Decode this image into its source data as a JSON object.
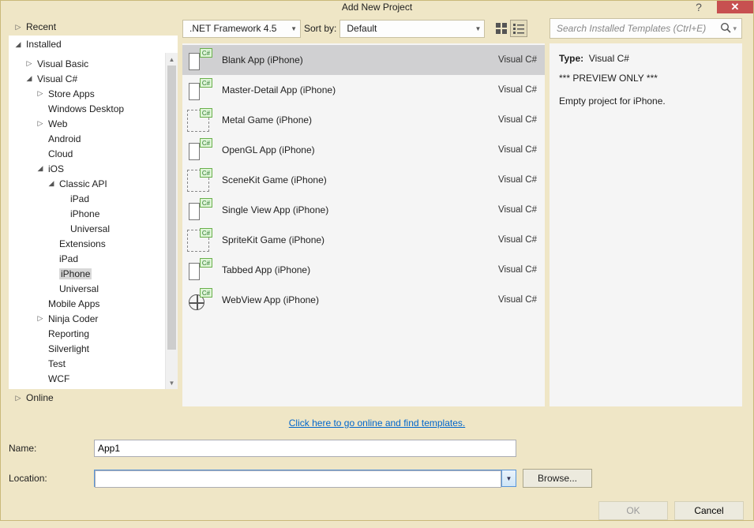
{
  "window": {
    "title": "Add New Project"
  },
  "tree": {
    "recent": "Recent",
    "installed": "Installed",
    "online": "Online",
    "items": [
      {
        "label": "Visual Basic",
        "indent": 1,
        "exp": "▷"
      },
      {
        "label": "Visual C#",
        "indent": 1,
        "exp": "◢"
      },
      {
        "label": "Store Apps",
        "indent": 2,
        "exp": "▷"
      },
      {
        "label": "Windows Desktop",
        "indent": 2,
        "exp": ""
      },
      {
        "label": "Web",
        "indent": 2,
        "exp": "▷"
      },
      {
        "label": "Android",
        "indent": 2,
        "exp": ""
      },
      {
        "label": "Cloud",
        "indent": 2,
        "exp": ""
      },
      {
        "label": "iOS",
        "indent": 2,
        "exp": "◢"
      },
      {
        "label": "Classic API",
        "indent": 3,
        "exp": "◢"
      },
      {
        "label": "iPad",
        "indent": 4,
        "exp": ""
      },
      {
        "label": "iPhone",
        "indent": 4,
        "exp": ""
      },
      {
        "label": "Universal",
        "indent": 4,
        "exp": ""
      },
      {
        "label": "Extensions",
        "indent": 3,
        "exp": ""
      },
      {
        "label": "iPad",
        "indent": 3,
        "exp": ""
      },
      {
        "label": "iPhone",
        "indent": 3,
        "exp": "",
        "selected": true
      },
      {
        "label": "Universal",
        "indent": 3,
        "exp": ""
      },
      {
        "label": "Mobile Apps",
        "indent": 2,
        "exp": ""
      },
      {
        "label": "Ninja Coder",
        "indent": 2,
        "exp": "▷"
      },
      {
        "label": "Reporting",
        "indent": 2,
        "exp": ""
      },
      {
        "label": "Silverlight",
        "indent": 2,
        "exp": ""
      },
      {
        "label": "Test",
        "indent": 2,
        "exp": ""
      },
      {
        "label": "WCF",
        "indent": 2,
        "exp": ""
      }
    ]
  },
  "toolbar": {
    "framework": ".NET Framework 4.5",
    "sort_label": "Sort by:",
    "sort_value": "Default"
  },
  "templates": [
    {
      "name": "Blank App (iPhone)",
      "lang": "Visual C#",
      "selected": true,
      "icon": "phone"
    },
    {
      "name": "Master-Detail App (iPhone)",
      "lang": "Visual C#",
      "selected": false,
      "icon": "phone"
    },
    {
      "name": "Metal Game (iPhone)",
      "lang": "Visual C#",
      "selected": false,
      "icon": "canvas"
    },
    {
      "name": "OpenGL App (iPhone)",
      "lang": "Visual C#",
      "selected": false,
      "icon": "phone"
    },
    {
      "name": "SceneKit Game (iPhone)",
      "lang": "Visual C#",
      "selected": false,
      "icon": "canvas"
    },
    {
      "name": "Single View App (iPhone)",
      "lang": "Visual C#",
      "selected": false,
      "icon": "phone"
    },
    {
      "name": "SpriteKit Game (iPhone)",
      "lang": "Visual C#",
      "selected": false,
      "icon": "canvas"
    },
    {
      "name": "Tabbed App (iPhone)",
      "lang": "Visual C#",
      "selected": false,
      "icon": "phone"
    },
    {
      "name": "WebView App (iPhone)",
      "lang": "Visual C#",
      "selected": false,
      "icon": "globe"
    }
  ],
  "search": {
    "placeholder": "Search Installed Templates (Ctrl+E)"
  },
  "detail": {
    "type_label": "Type:",
    "type_value": "Visual C#",
    "preview": "*** PREVIEW ONLY ***",
    "desc": "Empty project for iPhone."
  },
  "link": "Click here to go online and find templates.",
  "form": {
    "name_label": "Name:",
    "name_value": "App1",
    "location_label": "Location:",
    "location_value": "",
    "browse": "Browse..."
  },
  "buttons": {
    "ok": "OK",
    "cancel": "Cancel"
  }
}
